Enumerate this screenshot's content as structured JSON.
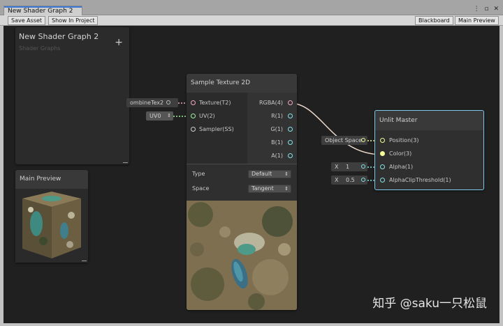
{
  "window": {
    "tab_title": "New Shader Graph 2",
    "controls": [
      "⋮",
      "▫",
      "✕"
    ]
  },
  "toolbar": {
    "save_asset": "Save Asset",
    "show_in_project": "Show In Project",
    "blackboard": "Blackboard",
    "main_preview": "Main Preview"
  },
  "blackboard": {
    "title": "New Shader Graph 2",
    "subtitle": "Shader Graphs",
    "add": "+"
  },
  "main_preview": {
    "title": "Main Preview"
  },
  "inputs_left": {
    "texture_prop": "ombineTex2",
    "uv": "UV0"
  },
  "sample_texture": {
    "title": "Sample Texture 2D",
    "inputs": [
      "Texture(T2)",
      "UV(2)",
      "Sampler(SS)"
    ],
    "outputs": [
      "RGBA(4)",
      "R(1)",
      "G(1)",
      "B(1)",
      "A(1)"
    ],
    "type_label": "Type",
    "type_value": "Default",
    "space_label": "Space",
    "space_value": "Tangent"
  },
  "unlit_master": {
    "title": "Unlit Master",
    "ports": [
      "Position(3)",
      "Color(3)",
      "Alpha(1)",
      "AlphaClipThreshold(1)"
    ],
    "position_input": "Object Space",
    "alpha_input": {
      "axis": "X",
      "value": "1"
    },
    "clip_input": {
      "axis": "X",
      "value": "0.5"
    }
  },
  "watermark": "知乎 @saku一只松鼠",
  "colors": {
    "accent_tab": "#3a78d4",
    "master_outline": "#7fc9ec",
    "port_texture": "#f1a7bb",
    "port_vector2": "#9ff29f",
    "port_float": "#84e4e7",
    "port_vector3": "#f6ff9a",
    "wire_rgba": "#e7c7e2"
  }
}
